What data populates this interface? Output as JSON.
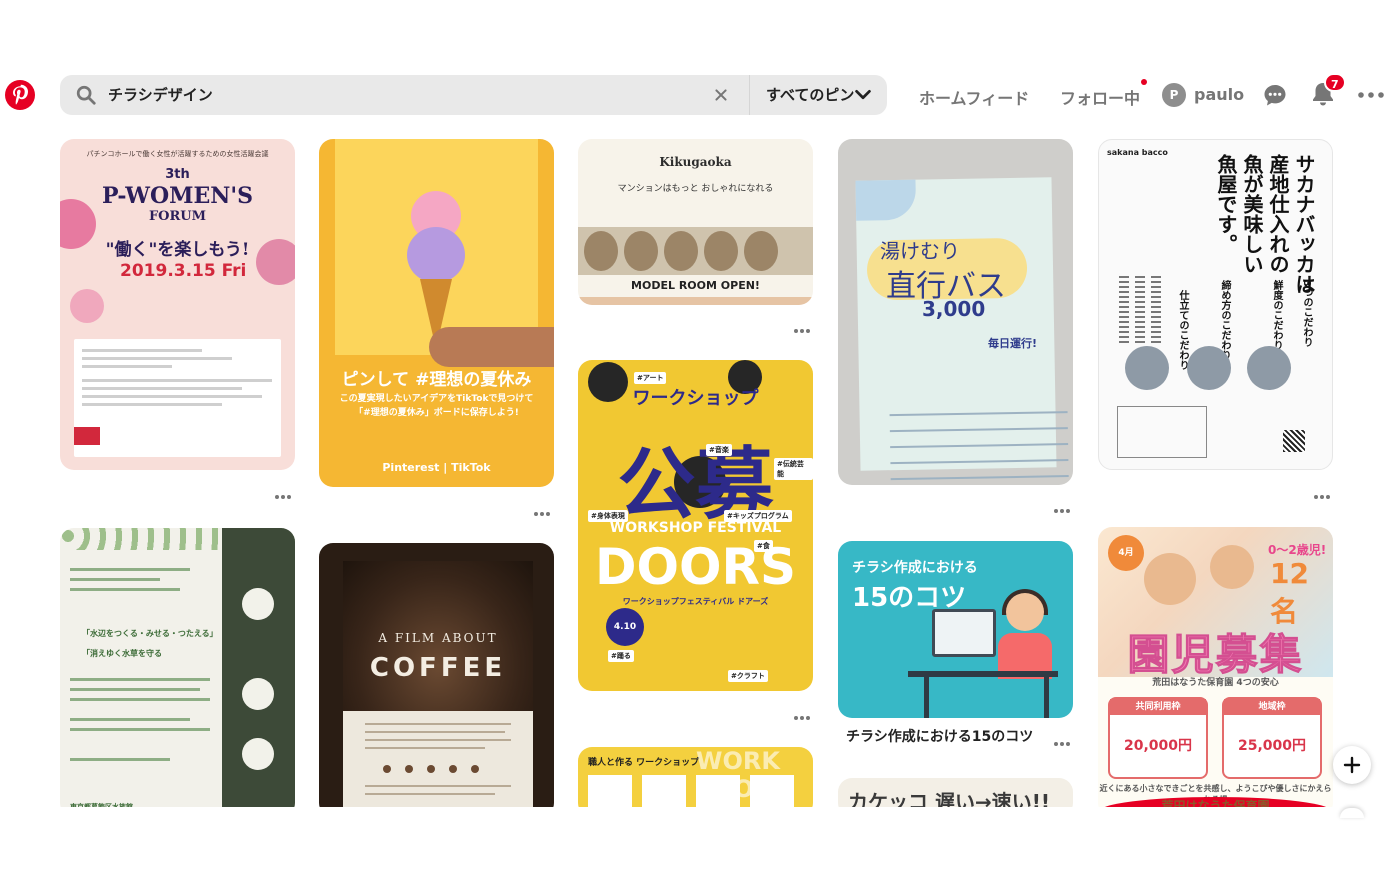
{
  "header": {
    "search_query": "チラシデザイン",
    "filter_label": "すべてのピン",
    "nav_home": "ホームフィード",
    "nav_following": "フォロー中",
    "avatar_initial": "P",
    "username": "paulo",
    "notification_count": "7",
    "icons": [
      "pinterest-logo-icon",
      "search-icon",
      "clear-icon",
      "chevron-down-icon",
      "message-icon",
      "bell-icon",
      "more-icon"
    ]
  },
  "colors": {
    "brand": "#e60023",
    "search_bg": "#e9e9e9",
    "nav_text": "#767676"
  },
  "pins": {
    "p1": {
      "sub": "パチンコホールで働く女性が活躍するための女性活躍会議",
      "line1": "3th",
      "line2": "P-WOMEN'S",
      "line3": "FORUM",
      "line4": "\"働く\"を楽しもう!",
      "date": "2019.3.15 Fri"
    },
    "p2": {
      "headline": "ピンして #理想の夏休み",
      "sub1": "この夏実現したいアイデアをTikTokで見つけて",
      "sub2": "「#理想の夏休み」ボードに保存しよう!",
      "brands": "Pinterest | TikTok"
    },
    "p3": {
      "brand": "Kikugaoka",
      "lead": "マンションはもっと おしゃれになれる",
      "open": "MODEL ROOM OPEN!"
    },
    "p4": {
      "heading": "ワークショップ",
      "big": "公募",
      "festival": "WORKSHOP FESTIVAL",
      "doors": "DOORS",
      "sub": "ワークショップフェスティバル ドアーズ",
      "date": "4.10",
      "tags": [
        "#アート",
        "#音楽",
        "#伝統芸能",
        "#身体表現",
        "#キッズプログラム",
        "#食",
        "#踊る",
        "#クラフト"
      ]
    },
    "p5": {
      "title": "職人と作る ワークショップ",
      "deco": "WORK SHOP"
    },
    "p6": {
      "line1": "湯けむり",
      "line2": "直行バス",
      "price": "3,000",
      "daily": "毎日運行!"
    },
    "p7": {
      "brand": "sakana bacco",
      "v1": "サカナバッカは",
      "v2": "産地仕入れの",
      "v3": "魚が美味しい",
      "v4": "魚屋です。",
      "s1": "3つのこだわり",
      "s2": "鮮度のこだわり",
      "s3": "締め方のこだわり",
      "s4": "仕立てのこだわり"
    },
    "p8": {
      "t1": "「水辺をつくる・みせる・つたえる」",
      "t2": "「消えゆく水草を守る",
      "foot": "東京都葛飾区水族館"
    },
    "p9": {
      "line1": "A FILM ABOUT",
      "line2": "COFFEE"
    },
    "p10": {
      "line1": "チラシ作成における",
      "line2": "15のコツ",
      "caption": "チラシ作成における15のコツ"
    },
    "p11": {
      "text": "カケッコ 遅い→速い!!"
    },
    "p12": {
      "april": "4月",
      "age": "0〜2歳児!",
      "num": "12名",
      "title": "園児募集",
      "sub": "荒田はなうた保育園 4つの安心",
      "col1_head": "共同利用枠",
      "col1_value": "20,000円",
      "col2_head": "地域枠",
      "col2_value": "25,000円",
      "foot": "近くにある小さなできごとを共感し、ようこびや優しさにかえられる場",
      "logo": "荒田はなうた保育園"
    }
  },
  "fab_icon": "plus-icon"
}
